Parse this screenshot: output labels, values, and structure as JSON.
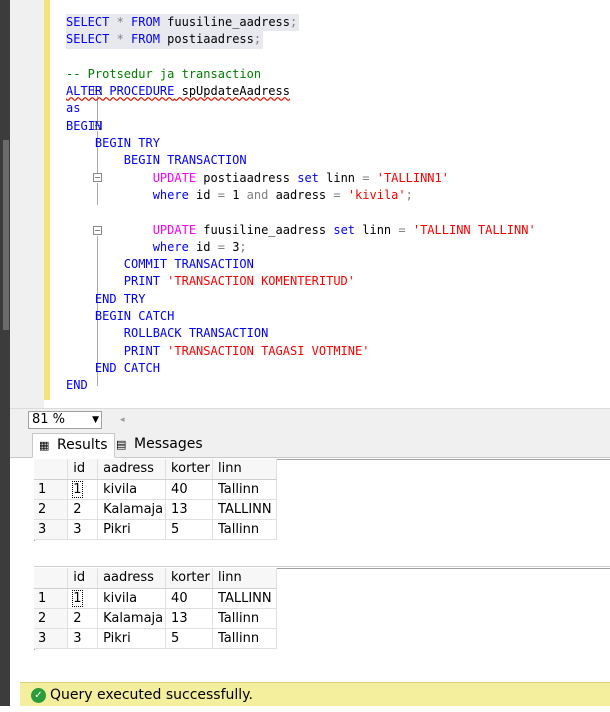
{
  "editor": {
    "lines": [
      {
        "parts": [
          [
            "kw",
            "SELECT"
          ],
          [
            "gray",
            " * "
          ],
          [
            "kw",
            "FROM"
          ],
          [
            "",
            " fuusiline_aadress"
          ],
          [
            "gray",
            ";"
          ]
        ],
        "sel": true
      },
      {
        "parts": [
          [
            "kw",
            "SELECT"
          ],
          [
            "gray",
            " * "
          ],
          [
            "kw",
            "FROM"
          ],
          [
            "",
            " postiaadress"
          ],
          [
            "gray",
            ";"
          ]
        ],
        "sel": true
      },
      {
        "parts": []
      },
      {
        "parts": [
          [
            "cm",
            "-- Protsedur ja transaction"
          ]
        ]
      },
      {
        "parts": [
          [
            "kw squig",
            "ALTER PROCEDURE"
          ],
          [
            "squig",
            " spUpdateAadress"
          ]
        ]
      },
      {
        "parts": [
          [
            "kw",
            "as"
          ]
        ]
      },
      {
        "parts": [
          [
            "kw",
            "BEGIN"
          ]
        ]
      },
      {
        "parts": [
          [
            "",
            "    "
          ],
          [
            "kw",
            "BEGIN TRY"
          ]
        ]
      },
      {
        "parts": [
          [
            "",
            "        "
          ],
          [
            "kw",
            "BEGIN TRANSACTION"
          ]
        ]
      },
      {
        "parts": [
          [
            "",
            "            "
          ],
          [
            "fn",
            "UPDATE"
          ],
          [
            "",
            " postiaadress "
          ],
          [
            "kw",
            "set"
          ],
          [
            "",
            " linn "
          ],
          [
            "gray",
            "="
          ],
          [
            "str",
            " 'TALLINN1'"
          ]
        ]
      },
      {
        "parts": [
          [
            "",
            "            "
          ],
          [
            "kw",
            "where"
          ],
          [
            "",
            " id "
          ],
          [
            "gray",
            "="
          ],
          [
            "",
            " 1 "
          ],
          [
            "gray",
            "and"
          ],
          [
            "",
            " aadress "
          ],
          [
            "gray",
            "="
          ],
          [
            "str",
            " 'kivila'"
          ],
          [
            "gray",
            ";"
          ]
        ]
      },
      {
        "parts": []
      },
      {
        "parts": [
          [
            "",
            "            "
          ],
          [
            "fn",
            "UPDATE"
          ],
          [
            "",
            " fuusiline_aadress "
          ],
          [
            "kw",
            "set"
          ],
          [
            "",
            " linn "
          ],
          [
            "gray",
            "="
          ],
          [
            "str",
            " 'TALLINN TALLINN'"
          ]
        ]
      },
      {
        "parts": [
          [
            "",
            "            "
          ],
          [
            "kw",
            "where"
          ],
          [
            "",
            " id "
          ],
          [
            "gray",
            "="
          ],
          [
            "",
            " 3"
          ],
          [
            "gray",
            ";"
          ]
        ]
      },
      {
        "parts": [
          [
            "",
            "        "
          ],
          [
            "kw",
            "COMMIT TRANSACTION"
          ]
        ]
      },
      {
        "parts": [
          [
            "",
            "        "
          ],
          [
            "kw",
            "PRINT"
          ],
          [
            "str",
            " 'TRANSACTION KOMENTERITUD'"
          ]
        ]
      },
      {
        "parts": [
          [
            "",
            "    "
          ],
          [
            "kw",
            "END TRY"
          ]
        ]
      },
      {
        "parts": [
          [
            "",
            "    "
          ],
          [
            "kw",
            "BEGIN CATCH"
          ]
        ]
      },
      {
        "parts": [
          [
            "",
            "        "
          ],
          [
            "kw",
            "ROLLBACK TRANSACTION"
          ]
        ]
      },
      {
        "parts": [
          [
            "",
            "        "
          ],
          [
            "kw",
            "PRINT"
          ],
          [
            "str",
            " 'TRANSACTION TAGASI VOTMINE'"
          ]
        ]
      },
      {
        "parts": [
          [
            "",
            "    "
          ],
          [
            "kw",
            "END CATCH"
          ]
        ]
      },
      {
        "parts": [
          [
            "kw",
            "END"
          ]
        ]
      }
    ]
  },
  "zoom": {
    "value": "81 %"
  },
  "tabs": {
    "results": "Results",
    "messages": "Messages"
  },
  "grid1": {
    "headers": [
      "id",
      "aadress",
      "korter",
      "linn"
    ],
    "rows": [
      {
        "rn": "1",
        "cells": [
          "1",
          "kivila",
          "40",
          "Tallinn"
        ]
      },
      {
        "rn": "2",
        "cells": [
          "2",
          "Kalamaja",
          "13",
          "TALLINN"
        ]
      },
      {
        "rn": "3",
        "cells": [
          "3",
          "Pikri",
          "5",
          "Tallinn"
        ]
      }
    ]
  },
  "grid2": {
    "headers": [
      "id",
      "aadress",
      "korter",
      "linn"
    ],
    "rows": [
      {
        "rn": "1",
        "cells": [
          "1",
          "kivila",
          "40",
          "TALLINN"
        ]
      },
      {
        "rn": "2",
        "cells": [
          "2",
          "Kalamaja",
          "13",
          "Tallinn"
        ]
      },
      {
        "rn": "3",
        "cells": [
          "3",
          "Pikri",
          "5",
          "Tallinn"
        ]
      }
    ]
  },
  "status": {
    "text": "Query executed successfully.",
    "icon": "check-icon"
  },
  "colors": {
    "status_bg": "#f4ef9c",
    "keyword": "#0000ff",
    "function": "#ff00ff",
    "string": "#ff0000",
    "comment": "#008000",
    "change_bar": "#f5e27a"
  }
}
